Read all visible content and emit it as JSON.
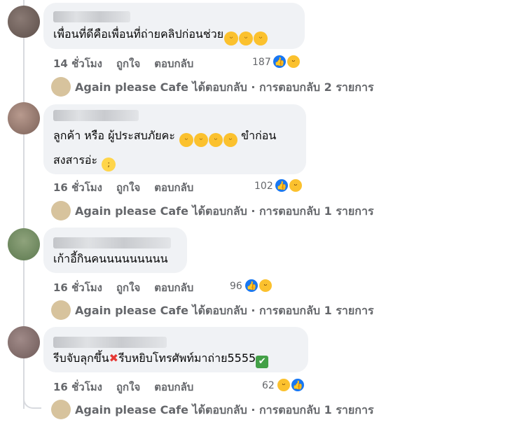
{
  "comments": [
    {
      "text_lines": [
        "เพื่อนที่ดีคือเพื่อนที่ถ่ายคลิปก่อนช่วย"
      ],
      "emoji": [
        "😄",
        "😄",
        "😄"
      ],
      "time": "14 ชั่วโมง",
      "like": "ถูกใจ",
      "reply": "ตอบกลับ",
      "reaction_count": "187",
      "reactions": [
        "like-icon",
        "haha-icon"
      ],
      "reply_summary": "Again please Cafe ได้ตอบกลับ · การตอบกลับ 2 รายการ"
    },
    {
      "text_lines": [
        "ลูกค้า หรือ ผู้ประสบภัยคะ",
        "สงสารอ่ะ"
      ],
      "line1_end": "ขำก่อน",
      "emoji": [
        "🤣",
        "🤣",
        "🤣",
        "🤣"
      ],
      "emoji2": [
        "😭"
      ],
      "time": "16 ชั่วโมง",
      "like": "ถูกใจ",
      "reply": "ตอบกลับ",
      "reaction_count": "102",
      "reactions": [
        "like-icon",
        "haha-icon"
      ],
      "reply_summary": "Again please Cafe ได้ตอบกลับ · การตอบกลับ 1 รายการ"
    },
    {
      "text_lines": [
        "เก้าอี้กินคนนนนนนนนน"
      ],
      "time": "16 ชั่วโมง",
      "like": "ถูกใจ",
      "reply": "ตอบกลับ",
      "reaction_count": "96",
      "reactions": [
        "like-icon",
        "haha-icon"
      ],
      "reply_summary": "Again please Cafe ได้ตอบกลับ · การตอบกลับ 1 รายการ"
    },
    {
      "text_part1": "รีบจับลุกขึ้น",
      "text_part2": "รีบหยิบโทรศัพท์มาถ่าย5555",
      "time": "16 ชั่วโมง",
      "like": "ถูกใจ",
      "reply": "ตอบกลับ",
      "reaction_count": "62",
      "reactions": [
        "haha-icon",
        "like-icon"
      ],
      "reply_summary": "Again please Cafe ได้ตอบกลับ · การตอบกลับ 1 รายการ"
    }
  ],
  "colors": {
    "meta": "#65676b",
    "bubble": "#f0f2f5",
    "like": "#1877f2",
    "haha": "#fbc12e"
  },
  "icons": {
    "x_mark": "cross-mark-icon",
    "check_mark": "check-mark-icon"
  }
}
